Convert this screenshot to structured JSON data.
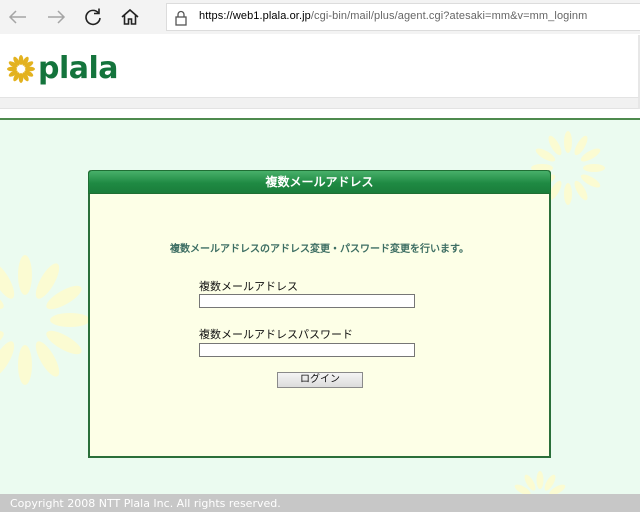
{
  "browser": {
    "url_host": "https://web1.plala.or.jp",
    "url_path": "/cgi-bin/mail/plus/agent.cgi?atesaki=mm&v=mm_loginm"
  },
  "site": {
    "logo_text": "plala",
    "brand_color": "#14743c"
  },
  "panel": {
    "title": "複数メールアドレス",
    "lead": "複数メールアドレスのアドレス変更・パスワード変更を行います。",
    "address_label": "複数メールアドレス",
    "address_value": "",
    "password_label": "複数メールアドレスパスワード",
    "password_value": "",
    "login_button": "ログイン"
  },
  "footer": {
    "copyright": "Copyright 2008 NTT Plala Inc. All rights reserved."
  },
  "icons": [
    "back-arrow-icon",
    "forward-arrow-icon",
    "refresh-icon",
    "home-icon",
    "lock-icon",
    "plala-logo-flower-icon"
  ]
}
